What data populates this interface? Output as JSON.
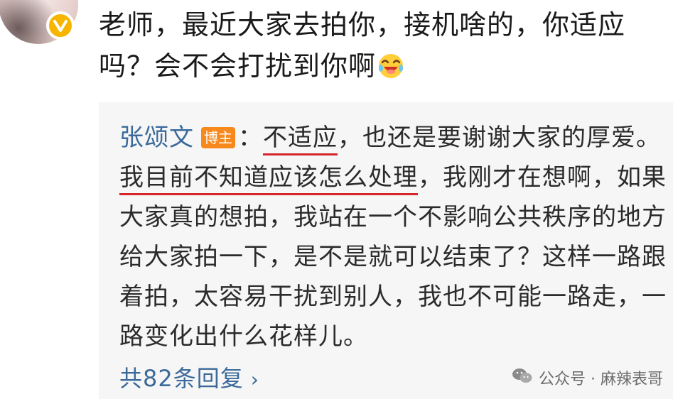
{
  "comment": {
    "line1": "老师，最近大家去拍你，接机啥的，你适应",
    "line2": "吗？会不会打扰到你啊",
    "emoji_icon": "laughing-tears-emoji-icon"
  },
  "reply": {
    "author": "张颂文",
    "badge": "博主",
    "colon": "：",
    "seg1_underlined": "不适应",
    "seg2": "，也还是要谢谢大家的厚爱。",
    "seg3_underlined": "我目前不知道应该怎么处理",
    "seg4": "，我刚才在想啊，如果大家真的想拍，我站在一个不影响公共秩序的地方给大家拍一下，是不是就可以结束了？这样一路跟着拍，太容易干扰到别人，我也不可能一路走，一路变化出什么花样儿。"
  },
  "replies": {
    "count_label": "共82条回复",
    "chevron": "›"
  },
  "watermark": {
    "text": "公众号 · 麻辣表哥"
  },
  "colors": {
    "author": "#3b6a9a",
    "badge": "#f7891c",
    "underline": "#d6262a",
    "verified": "#f7b500"
  }
}
